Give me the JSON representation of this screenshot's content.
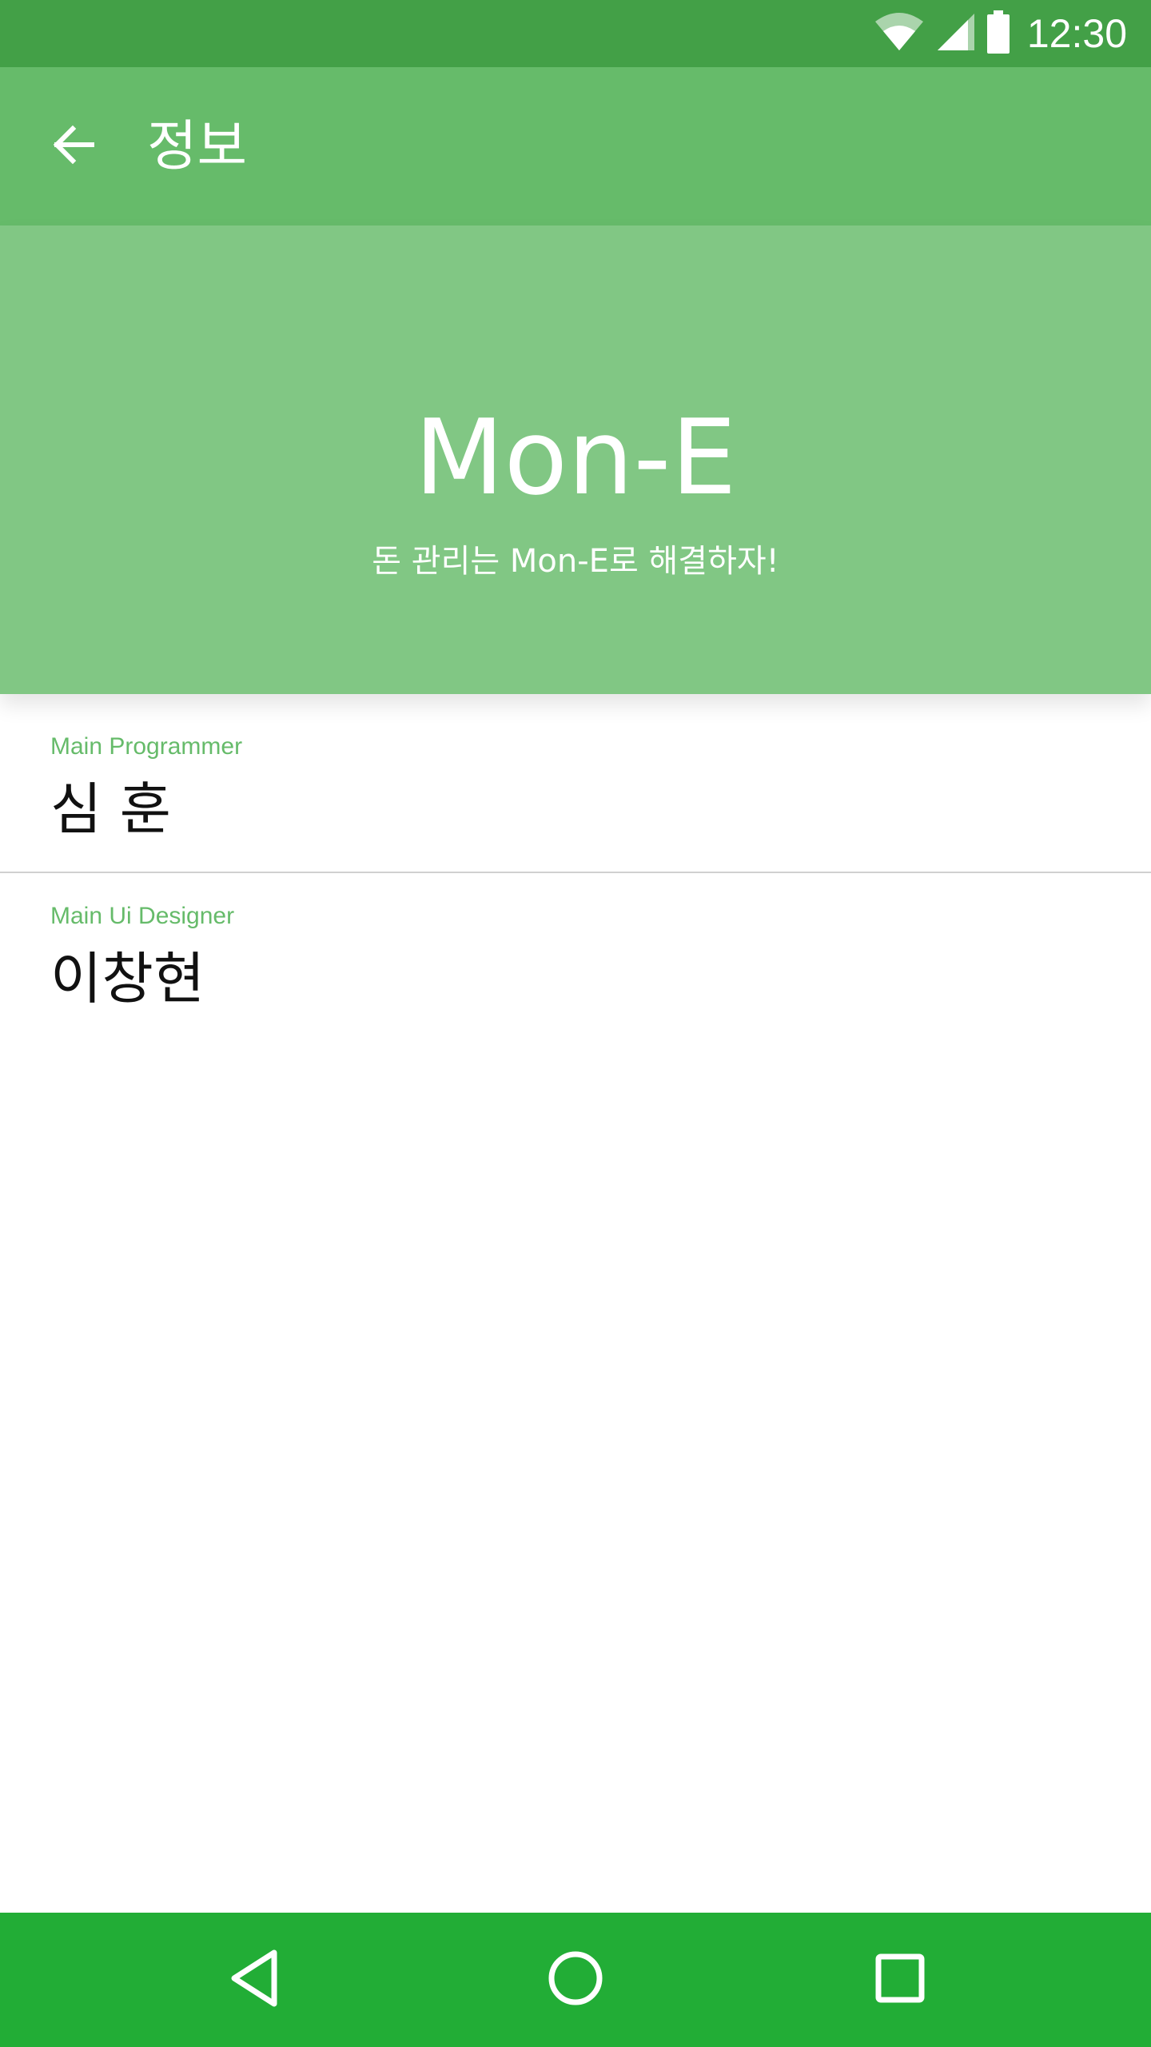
{
  "status_bar": {
    "time": "12:30",
    "icons": [
      "wifi-icon",
      "signal-icon",
      "battery-icon"
    ]
  },
  "app_bar": {
    "title": "정보",
    "back_icon": "arrow-back-icon"
  },
  "hero": {
    "title": "Mon-E",
    "subtitle": "돈 관리는 Mon-E로 해결하자!"
  },
  "credits": [
    {
      "role": "Main Programmer",
      "name": "심 훈"
    },
    {
      "role": "Main Ui Designer",
      "name": "이창현"
    }
  ],
  "nav_bar": {
    "icons": [
      "nav-back-icon",
      "nav-home-icon",
      "nav-recents-icon"
    ]
  },
  "colors": {
    "status_bar": "#43a047",
    "app_bar": "#66bb6a",
    "hero": "#81c784",
    "accent_text": "#66bb6a",
    "nav_bar": "#22ad36"
  }
}
